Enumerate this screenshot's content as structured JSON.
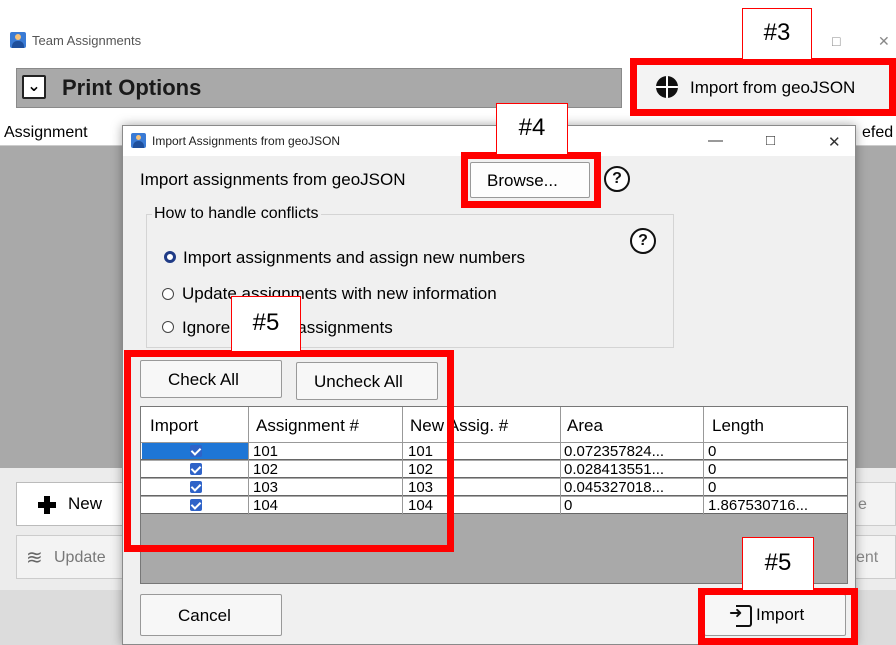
{
  "main_window": {
    "title": "Team Assignments",
    "print_options_label": "Print Options",
    "import_geojson_label": "Import from geoJSON",
    "grid_header_left": "Assignment",
    "grid_header_right": "efed",
    "new_label": "New",
    "update_label": "Update",
    "right_button_1_label": "e",
    "right_button_2_label": "ent",
    "window_controls": {
      "minimize": "—",
      "maximize": "□",
      "close": "✕"
    }
  },
  "dialog": {
    "title": "Import Assignments from geoJSON",
    "window_controls": {
      "minimize": "—",
      "maximize": "□",
      "close": "✕"
    },
    "prompt": "Import assignments from geoJSON",
    "browse_label": "Browse...",
    "help_glyph": "?",
    "conflicts": {
      "legend": "How to handle conflicts",
      "options": [
        {
          "label": "Import assignments and assign new numbers",
          "selected": true
        },
        {
          "label": "Update assignments with new information",
          "selected": false
        },
        {
          "label": "Ignore existing assignments",
          "selected": false
        }
      ]
    },
    "check_all_label": "Check All",
    "uncheck_all_label": "Uncheck All",
    "table": {
      "columns": [
        "Import",
        "Assignment #",
        "New Assig. #",
        "Area",
        "Length"
      ],
      "rows": [
        {
          "checked": true,
          "assignment": "101",
          "new_assignment": "101",
          "area": "0.072357824...",
          "length": "0"
        },
        {
          "checked": true,
          "assignment": "102",
          "new_assignment": "102",
          "area": "0.028413551...",
          "length": "0"
        },
        {
          "checked": true,
          "assignment": "103",
          "new_assignment": "103",
          "area": "0.045327018...",
          "length": "0"
        },
        {
          "checked": true,
          "assignment": "104",
          "new_assignment": "104",
          "area": "0",
          "length": "1.867530716..."
        }
      ]
    },
    "cancel_label": "Cancel",
    "import_label": "Import"
  },
  "annotations": {
    "tag_3": "#3",
    "tag_4": "#4",
    "tag_5_upper": "#5",
    "tag_5_lower": "#5",
    "highlight_color": "#ff0000"
  }
}
